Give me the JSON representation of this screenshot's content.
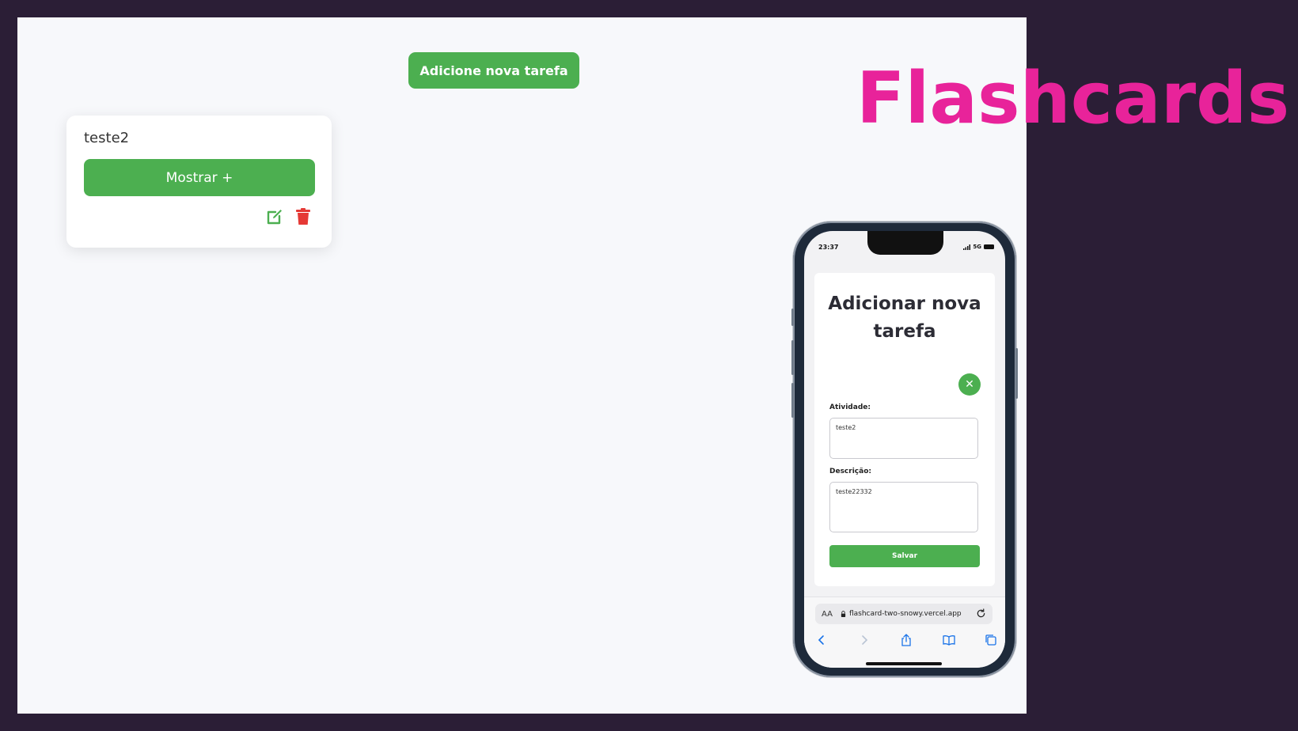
{
  "app": {
    "add_task_label": "Adicione nova tarefa",
    "card": {
      "title": "teste2",
      "show_label": "Mostrar +",
      "icons": [
        "edit-icon",
        "trash-icon"
      ]
    }
  },
  "headline": "Flashcards",
  "phone": {
    "status": {
      "time": "23:37",
      "network": "5G"
    },
    "modal": {
      "title": "Adicionar nova tarefa",
      "close_label": "✕",
      "activity_label": "Atividade:",
      "activity_value": "teste2",
      "description_label": "Descrição:",
      "description_value": "teste22332",
      "save_label": "Salvar"
    },
    "browser": {
      "aa_label": "AA",
      "url": "flashcard-two-snowy.vercel.app",
      "icons": [
        "back-icon",
        "forward-icon",
        "share-icon",
        "bookmarks-icon",
        "tabs-icon"
      ]
    }
  },
  "colors": {
    "accent_green": "#4caf50",
    "delete_red": "#e53935",
    "headline_pink": "#e8239a",
    "background": "#2b1e36",
    "app_background": "#f7f8fb"
  }
}
